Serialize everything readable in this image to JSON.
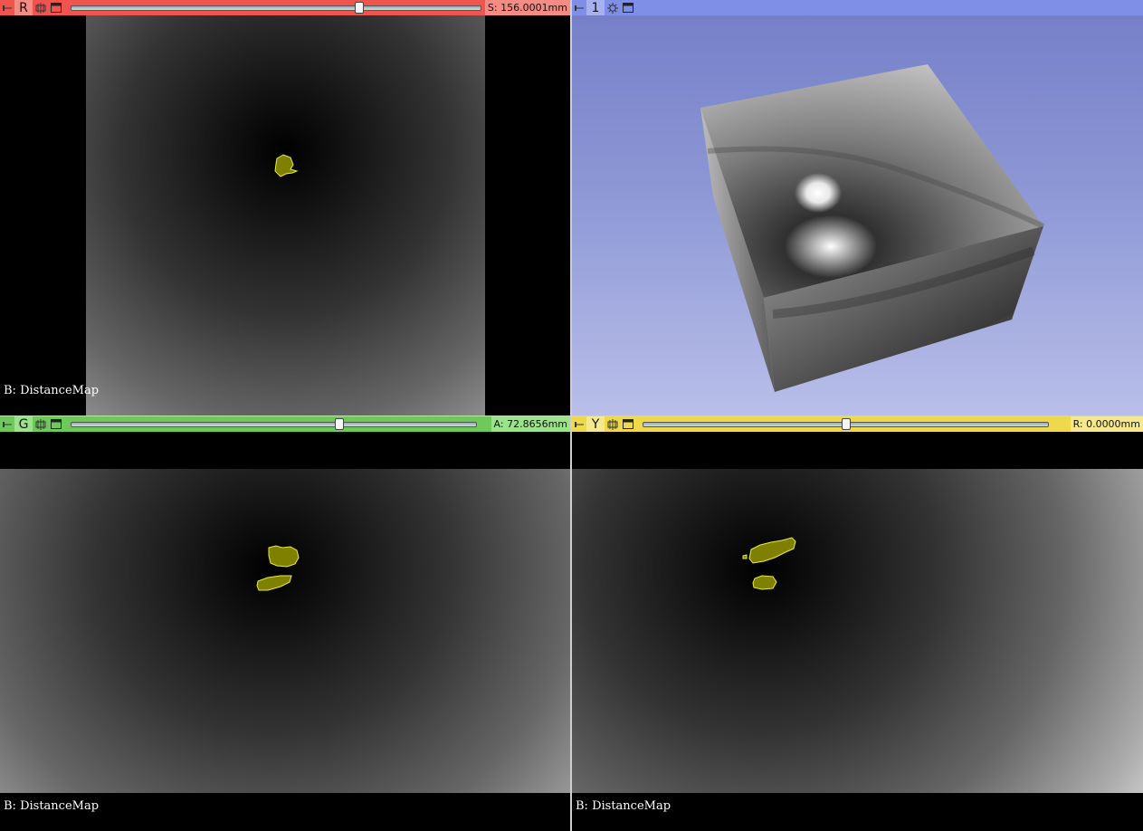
{
  "colors": {
    "red_bar": "#f0544e",
    "green_bar": "#6ec95a",
    "yellow_bar": "#eed84c",
    "blue_bar": "#7f8fe8",
    "segment_fill": "#7f7f00",
    "segment_outline": "#e8ef3a"
  },
  "views": {
    "red": {
      "letter": "R",
      "position": "S: 156.0001mm",
      "slice_fraction": 0.71,
      "label": "B: DistanceMap"
    },
    "three_d": {
      "letter": "1"
    },
    "green": {
      "letter": "G",
      "position": "A: 72.8656mm",
      "slice_fraction": 0.66,
      "label": "B: DistanceMap"
    },
    "yellow": {
      "letter": "Y",
      "position": "R: 0.0000mm",
      "slice_fraction": 0.5,
      "label": "B: DistanceMap"
    }
  },
  "icons": [
    "pin-icon",
    "link-icon",
    "maximize-icon",
    "gear-icon"
  ]
}
